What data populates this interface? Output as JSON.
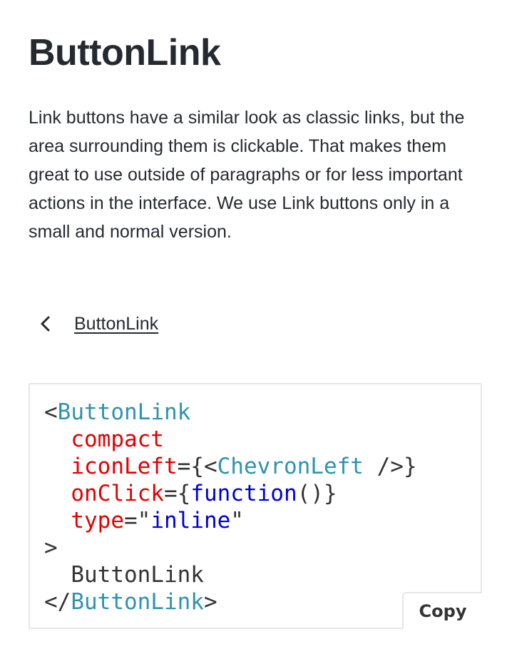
{
  "page": {
    "title": "ButtonLink",
    "description": "Link buttons have a similar look as classic links, but the area surrounding them is clickable. That makes them great to use outside of paragraphs or for less important actions in the interface. We use Link buttons only in a small and normal version."
  },
  "demo": {
    "button_label": "ButtonLink",
    "icon": "chevron-left-icon"
  },
  "code": {
    "open_bracket": "<",
    "component": "ButtonLink",
    "prop_compact": "compact",
    "prop_icon_left": "iconLeft",
    "eq_brace_lt": "={<",
    "icon_component": "ChevronLeft",
    "self_close": " />}",
    "prop_on_click": "onClick",
    "eq_brace": "={",
    "function_kw": "function",
    "fn_tail": "()}",
    "prop_type": "type",
    "eq_quote": "=\"",
    "type_value": "inline",
    "close_quote": "\"",
    "gt": ">",
    "children": "ButtonLink",
    "close_open": "</",
    "close_component": "ButtonLink",
    "close_gt": ">",
    "copy_label": "Copy"
  },
  "colors": {
    "text": "#252a31",
    "code_tag": "#2e93ad",
    "code_attr": "#e30000",
    "code_value": "#0000d6",
    "border": "#e6e6e6"
  }
}
